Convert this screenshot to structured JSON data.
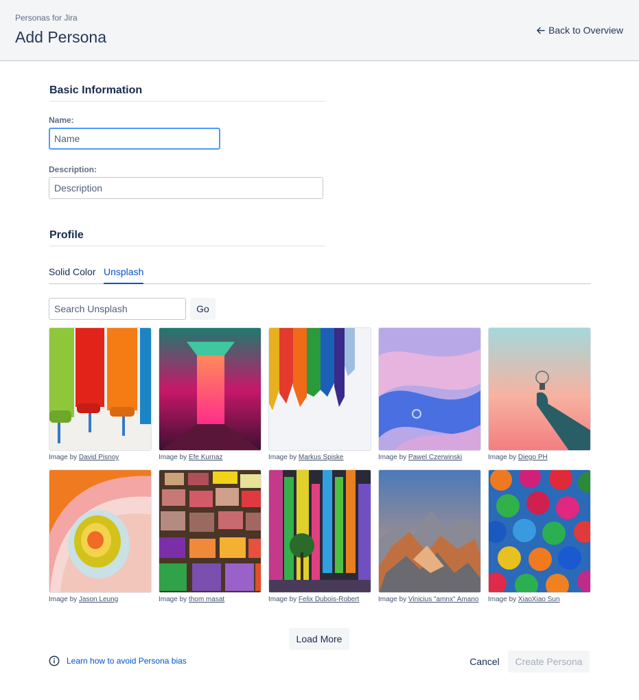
{
  "header": {
    "app_name": "Personas for Jira",
    "title": "Add Persona",
    "back_link": "Back to Overview"
  },
  "basic_info": {
    "heading": "Basic Information",
    "name_label": "Name:",
    "name_placeholder": "Name",
    "description_label": "Description:",
    "description_placeholder": "Description"
  },
  "profile": {
    "heading": "Profile",
    "tabs": [
      {
        "label": "Solid Color",
        "active": false
      },
      {
        "label": "Unsplash",
        "active": true
      }
    ],
    "search_placeholder": "Search Unsplash",
    "go_label": "Go"
  },
  "images": [
    {
      "prefix": "Image by",
      "author": "David Pisnoy"
    },
    {
      "prefix": "Image by",
      "author": "Efe Kurnaz"
    },
    {
      "prefix": "Image by",
      "author": "Markus Spiske"
    },
    {
      "prefix": "Image by",
      "author": "Pawel Czerwinski"
    },
    {
      "prefix": "Image by",
      "author": "Diego PH"
    },
    {
      "prefix": "Image by",
      "author": "Jason Leung"
    },
    {
      "prefix": "Image by",
      "author": "thom masat"
    },
    {
      "prefix": "Image by",
      "author": "Felix Dubois-Robert"
    },
    {
      "prefix": "Image by",
      "author": "Vinicius \"amnx\" Amano"
    },
    {
      "prefix": "Image by",
      "author": "XiaoXiao Sun"
    }
  ],
  "footer": {
    "load_more": "Load More",
    "bias_link": "Learn how to avoid Persona bias",
    "cancel": "Cancel",
    "create": "Create Persona"
  },
  "colors": {
    "accent": "#0052cc",
    "focus": "#4c9aff",
    "header_bg": "#f4f5f7"
  }
}
